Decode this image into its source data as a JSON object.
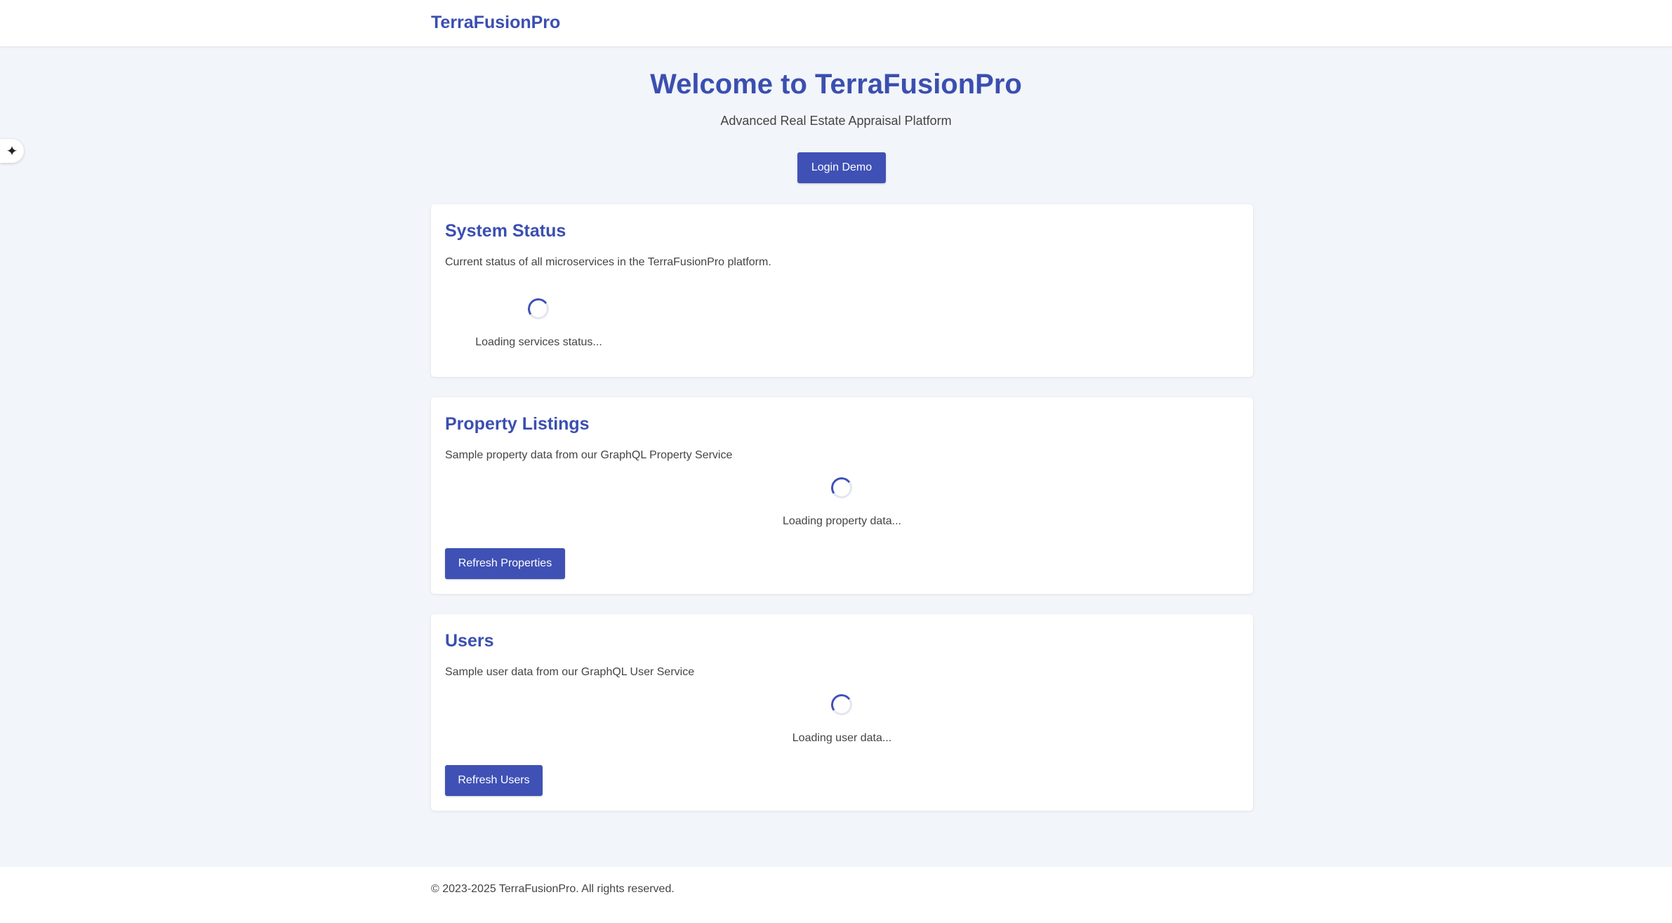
{
  "header": {
    "brand": "TerraFusionPro"
  },
  "hero": {
    "title": "Welcome to TerraFusionPro",
    "subtitle": "Advanced Real Estate Appraisal Platform",
    "login_label": "Login Demo"
  },
  "system_status": {
    "title": "System Status",
    "description": "Current status of all microservices in the TerraFusionPro platform.",
    "loading_text": "Loading services status..."
  },
  "properties": {
    "title": "Property Listings",
    "description": "Sample property data from our GraphQL Property Service",
    "loading_text": "Loading property data...",
    "refresh_label": "Refresh Properties"
  },
  "users": {
    "title": "Users",
    "description": "Sample user data from our GraphQL User Service",
    "loading_text": "Loading user data...",
    "refresh_label": "Refresh Users"
  },
  "footer": {
    "copyright": "© 2023-2025 TerraFusionPro. All rights reserved."
  },
  "side_widget": {
    "icon": "sparkle-icon"
  },
  "colors": {
    "accent": "#3f51b5",
    "heading": "#3b4fb0",
    "background": "#f2f5f9"
  }
}
